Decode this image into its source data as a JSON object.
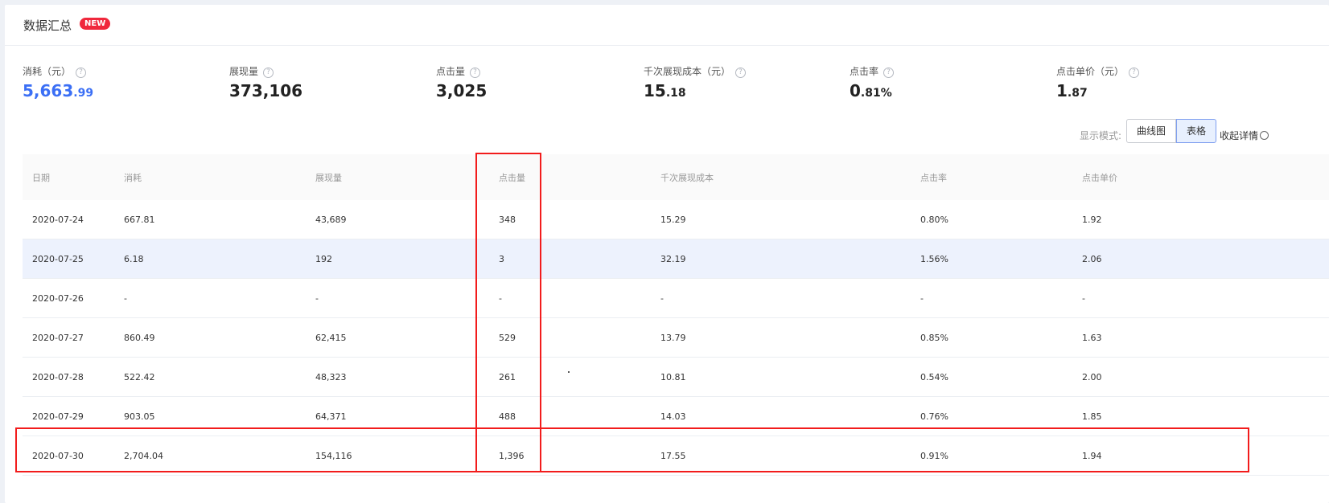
{
  "header": {
    "title": "数据汇总",
    "badge": "NEW"
  },
  "stats": [
    {
      "label": "消耗（元）",
      "int": "5,663",
      "dec": ".99",
      "help": "?"
    },
    {
      "label": "展现量",
      "int": "373,106",
      "dec": "",
      "help": "?"
    },
    {
      "label": "点击量",
      "int": "3,025",
      "dec": "",
      "help": "?"
    },
    {
      "label": "千次展现成本（元）",
      "int": "15",
      "dec": ".18",
      "help": "?"
    },
    {
      "label": "点击率",
      "int": "0",
      "dec": ".81%",
      "help": "?"
    },
    {
      "label": "点击单价（元）",
      "int": "1",
      "dec": ".87",
      "help": "?"
    }
  ],
  "view_mode": {
    "label": "显示模式:",
    "options": [
      "曲线图",
      "表格"
    ],
    "selected": "表格",
    "collapse": "收起详情"
  },
  "table": {
    "columns": [
      "日期",
      "消耗",
      "展现量",
      "点击量",
      "千次展现成本",
      "点击率",
      "点击单价"
    ],
    "rows": [
      [
        "2020-07-24",
        "667.81",
        "43,689",
        "348",
        "15.29",
        "0.80%",
        "1.92"
      ],
      [
        "2020-07-25",
        "6.18",
        "192",
        "3",
        "32.19",
        "1.56%",
        "2.06"
      ],
      [
        "2020-07-26",
        "-",
        "-",
        "-",
        "-",
        "-",
        "-"
      ],
      [
        "2020-07-27",
        "860.49",
        "62,415",
        "529",
        "13.79",
        "0.85%",
        "1.63"
      ],
      [
        "2020-07-28",
        "522.42",
        "48,323",
        "261",
        "10.81",
        "0.54%",
        "2.00"
      ],
      [
        "2020-07-29",
        "903.05",
        "64,371",
        "488",
        "14.03",
        "0.76%",
        "1.85"
      ],
      [
        "2020-07-30",
        "2,704.04",
        "154,116",
        "1,396",
        "17.55",
        "0.91%",
        "1.94"
      ]
    ],
    "highlight_row": 1
  },
  "colors": {
    "accent": "#3b6ff5",
    "badge": "#f0283c",
    "annotation": "#f21c1c"
  }
}
